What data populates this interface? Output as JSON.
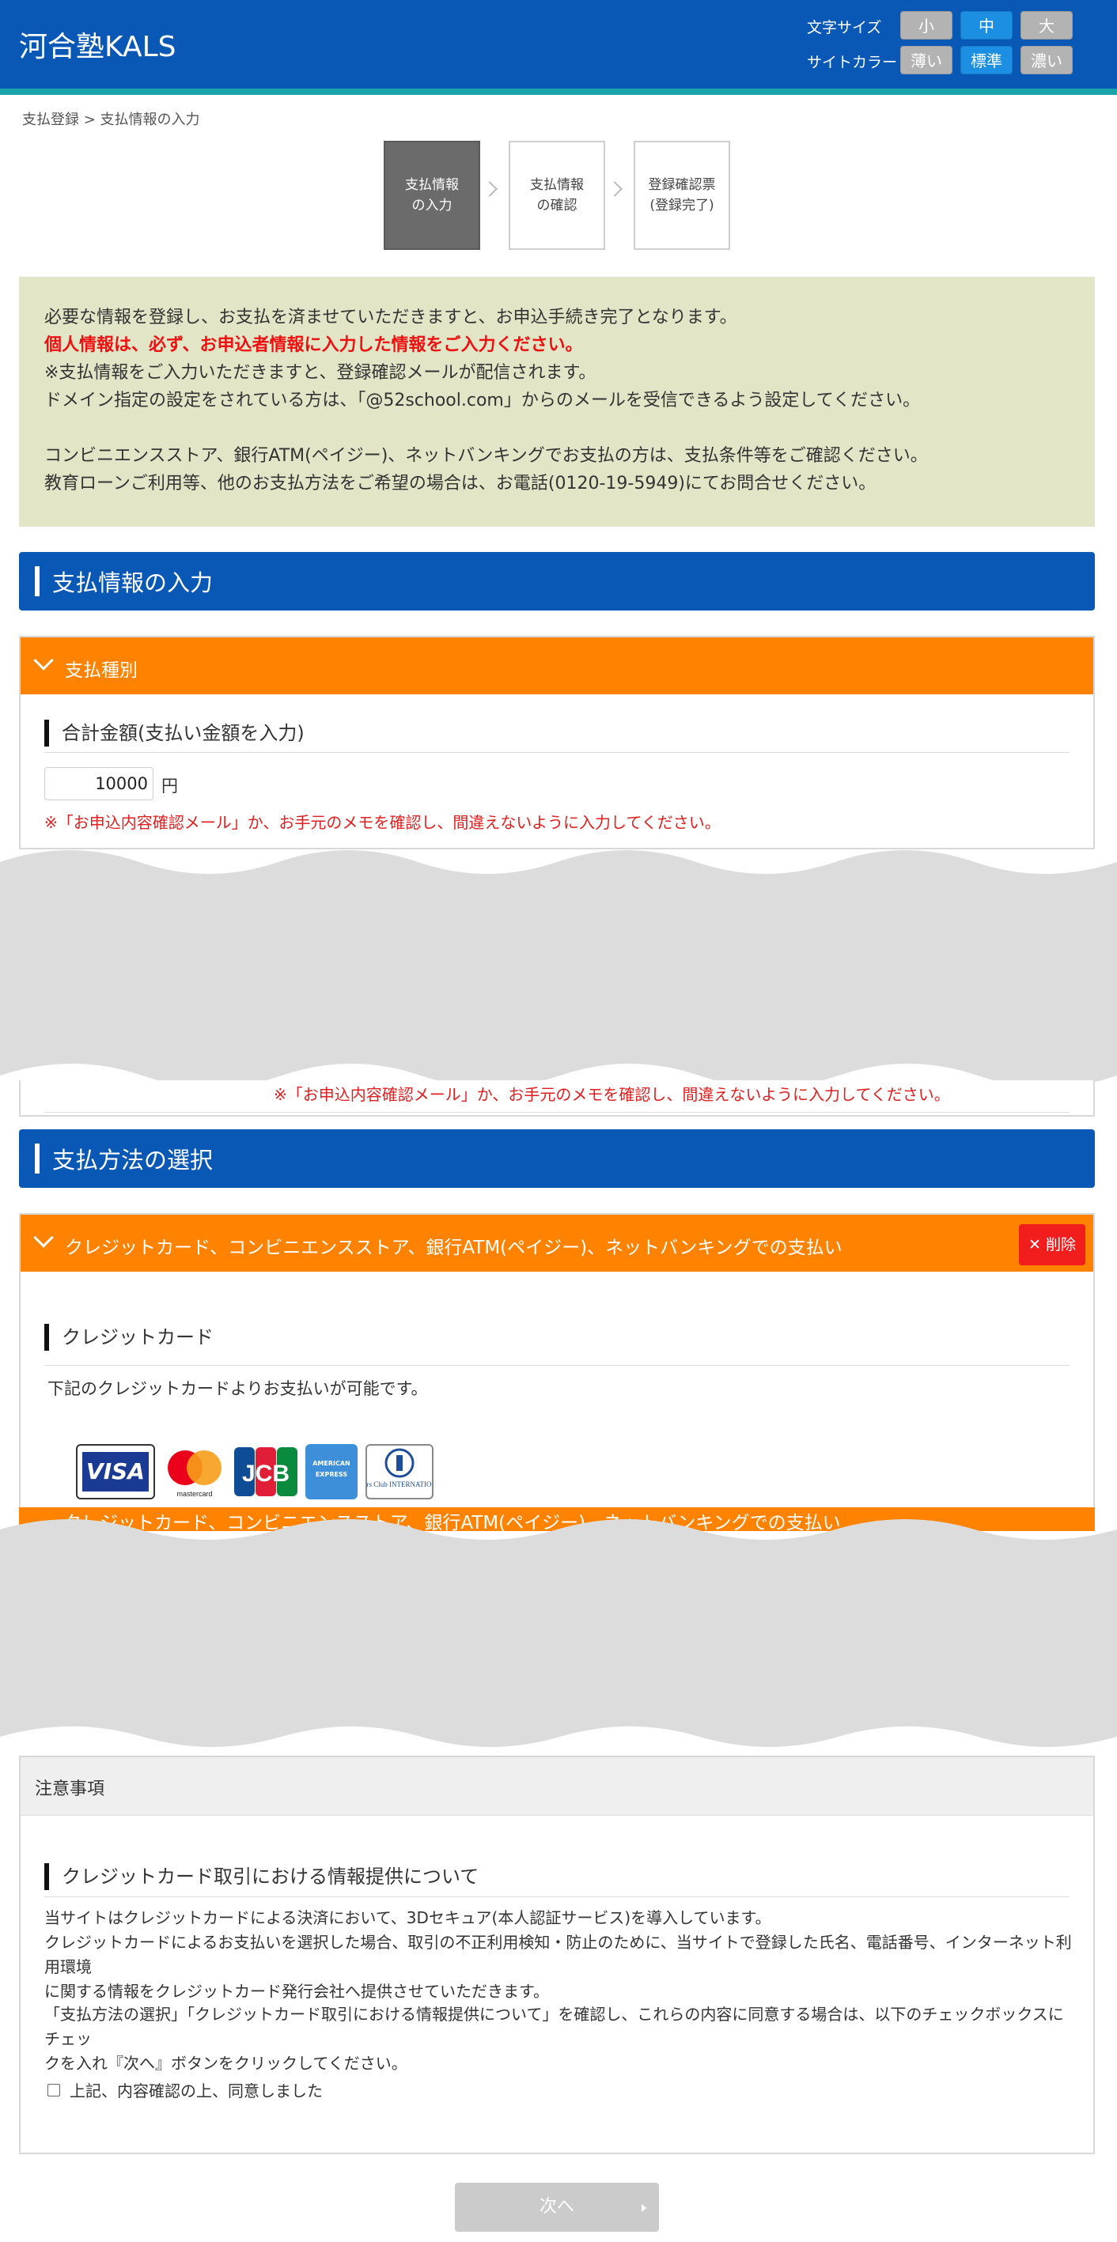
{
  "header": {
    "logo": "河合塾KALS",
    "font_size_label": "文字サイズ",
    "font_size_options": [
      "小",
      "中",
      "大"
    ],
    "site_color_label": "サイトカラー",
    "site_color_options": [
      "薄い",
      "標準",
      "濃い"
    ],
    "active_font_size": "中",
    "active_site_color": "標準"
  },
  "breadcrumb": "支払登録 > 支払情報の入力",
  "steps": [
    {
      "line1": "支払情報",
      "line2": "の入力",
      "active": true
    },
    {
      "line1": "支払情報",
      "line2": "の確認",
      "active": false
    },
    {
      "line1": "登録確認票",
      "line2": "(登録完了)",
      "active": false
    }
  ],
  "notice": {
    "line1": "必要な情報を登録し、お支払を済ませていただきますと、お申込手続き完了となります。",
    "line2_red": "個人情報は、必ず、お申込者情報に入力した情報をご入力ください。",
    "line3": "※支払情報をご入力いただきますと、登録確認メールが配信されます。",
    "line4": "ドメイン指定の設定をされている方は、「@52school.com」からのメールを受信できるよう設定してください。",
    "line5": "コンビニエンスストア、銀行ATM(ペイジー)、ネットバンキングでお支払の方は、支払条件等をご確認ください。",
    "line6": "教育ローンご利用等、他のお支払方法をご希望の場合は、お電話(0120-19-5949)にてお問合せください。"
  },
  "section1": {
    "title": "支払情報の入力"
  },
  "payment_type": {
    "header": "支払種別",
    "amount_label": "合計金額(支払い金額を入力)",
    "amount_value": "10000",
    "unit": "円",
    "note": "※「お申込内容確認メール」か、お手元のメモを確認し、間違えないように入力してください。",
    "partial_note": "※「お申込内容確認メール」か、お手元のメモを確認し、間違えないように入力してください。"
  },
  "section2": {
    "title": "支払方法の選択"
  },
  "method": {
    "header": "クレジットカード、コンビニエンスストア、銀行ATM(ペイジー)、ネットバンキングでの支払い",
    "delete": "削除",
    "credit_title": "クレジットカード",
    "credit_desc": "下記のクレジットカードよりお支払いが可能です。",
    "cards": [
      "VISA",
      "mastercard",
      "JCB",
      "AMERICAN EXPRESS",
      "Diners Club INTERNATIONAL"
    ],
    "second_header_partial": "クレジットカード、コンビニエンスストア、銀行ATM(ペイジー)、ネットバンキングでの支払い"
  },
  "notes": {
    "header": "注意事項",
    "title": "クレジットカード取引における情報提供について",
    "p1_l1": "当サイトはクレジットカードによる決済において、3Dセキュア(本人認証サービス)を導入しています。",
    "p1_l2": "クレジットカードによるお支払いを選択した場合、取引の不正利用検知・防止のために、当サイトで登録した氏名、電話番号、インターネット利用環境",
    "p1_l3": "に関する情報をクレジットカード発行会社へ提供させていただきます。",
    "p2_l1": "「支払方法の選択」「クレジットカード取引における情報提供について」を確認し、これらの内容に同意する場合は、以下のチェックボックスにチェッ",
    "p2_l2": "クを入れ『次へ』ボタンをクリックしてください。",
    "agree": "上記、内容確認の上、同意しました"
  },
  "next_button": "次へ",
  "colors": {
    "header_blue": "#0a58b6",
    "accent_orange": "#ff8200",
    "notice_bg": "#e2e6c6",
    "alert_red": "#ee1111"
  }
}
